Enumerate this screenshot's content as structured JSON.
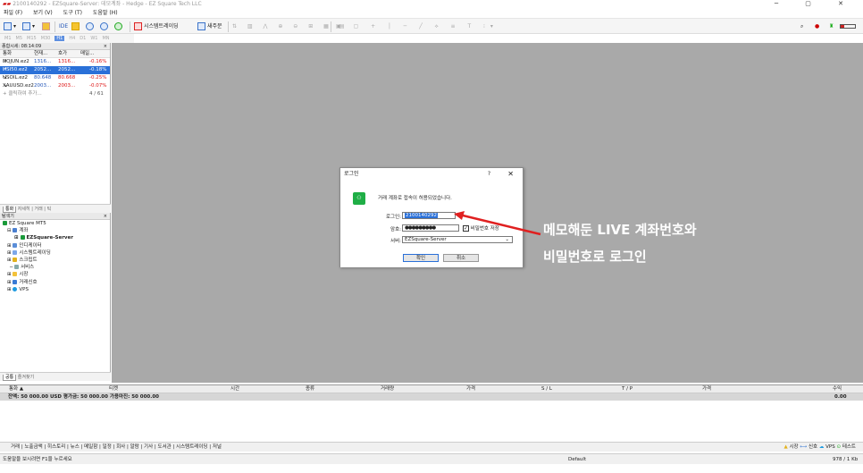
{
  "window": {
    "title": "2100140292 - EZSquare-Server: 데모계좌 - Hedge - EZ Square Tech LLC",
    "controls": "─  ▢  ✕"
  },
  "menu": [
    "파일 (F)",
    "보기 (V)",
    "도구 (T)",
    "도움말 (H)"
  ],
  "toolbar": {
    "ide_label": "IDE",
    "algo_label": "시스템트레이딩",
    "new_order_label": "새주문"
  },
  "timeframes": [
    "M1",
    "M5",
    "M15",
    "M30",
    "H1",
    "H4",
    "D1",
    "W1",
    "MN"
  ],
  "market_watch": {
    "header": "종합시세: 08:14:09",
    "cols": [
      "통화",
      "현재...",
      "호가",
      "매일..."
    ],
    "rows": [
      {
        "sym": "NQJUN.ez2",
        "bid": "1316...",
        "ask": "1316...",
        "chg": "-0.16%",
        "sel": false
      },
      {
        "sym": "HSI50.ez2",
        "bid": "2052...",
        "ask": "2052...",
        "chg": "-0.18%",
        "sel": true
      },
      {
        "sym": "USOIL.ez2",
        "bid": "80.648",
        "ask": "80.668",
        "chg": "-0.25%",
        "sel": false
      },
      {
        "sym": "XAUUSD.ez2",
        "bid": "2003...",
        "ask": "2003...",
        "chg": "-0.07%",
        "sel": false
      }
    ],
    "add": "+ 클릭하여 추가...",
    "count": "4 / 61",
    "tabs": [
      "통화",
      "자세히",
      "거래",
      "틱"
    ]
  },
  "navigator": {
    "header": "탐색기",
    "items": [
      "EZ Square MT5",
      "계좌",
      "EZSquare-Server",
      "인디케이터",
      "시스템트레이딩",
      "스크립트",
      "서비스",
      "시장",
      "거래신호",
      "VPS"
    ],
    "tabs": [
      "공통",
      "즐겨찾기"
    ]
  },
  "dialog": {
    "title": "로그인",
    "help": "?",
    "close": "✕",
    "message": "거래 계좌로 접속이 허용되었습니다.",
    "login_label": "로그인:",
    "login_value": "2100140292",
    "pass_label": "암호:",
    "pass_value": "●●●●●●●●●",
    "save_label": "비밀번호 저장",
    "server_label": "서버:",
    "server_value": "EZSquare-Server",
    "ok": "확인",
    "cancel": "취소"
  },
  "annotation": {
    "line1": "메모해둔 LIVE 계좌번호와",
    "line2": "비밀번호로 로그인",
    "color": "#e02020"
  },
  "trade": {
    "cols": [
      "통화 ▲",
      "티켓",
      "시간",
      "종류",
      "거래량",
      "가격",
      "S / L",
      "T / P",
      "가격",
      "수익"
    ],
    "balance": "잔액: 50 000.00 USD  평가금: 50 000.00  가용마진: 50 000.00",
    "profit": "0.00",
    "tabs": "거래 | 노출금액 | 히스토리 | 뉴스 | 메일함 | 일정 | 회사 | 알람 | 기사 | 도서관 | 시스템트레이딩 | 저널",
    "right": [
      "시장",
      "신호",
      "VPS",
      "테스트"
    ]
  },
  "status": {
    "left": "도움말을 보시려면 F1을 누르세요",
    "profile": "Default",
    "right": "978 / 1 Kb"
  }
}
